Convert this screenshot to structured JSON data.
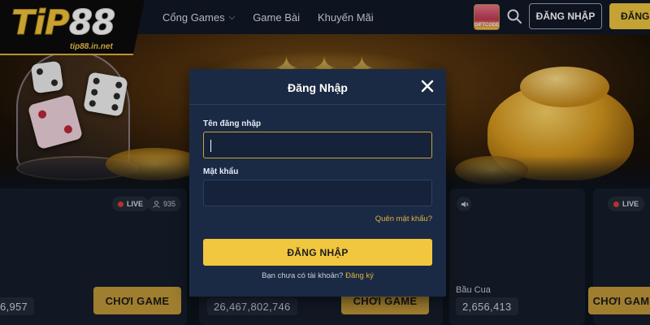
{
  "header": {
    "logo_tip": "TiP",
    "logo_num": "88",
    "logo_domain": "tip88.in.net",
    "nav": [
      {
        "label": "Cổng Games",
        "has_dropdown": true
      },
      {
        "label": "Game Bài"
      },
      {
        "label": "Khuyến Mãi"
      }
    ],
    "giftcode_label": "GIFTCODE",
    "login_label": "ĐĂNG NHẬP",
    "register_label": "ĐĂNG"
  },
  "cards": [
    {
      "jackpot": "6,957",
      "play_label": "CHƠI GAME"
    },
    {
      "live_label": "LIVE",
      "viewers": "935",
      "jackpot": "26,467,802,746",
      "play_label": "CHƠI GAME"
    },
    {
      "game_name": "Bầu Cua",
      "jackpot": "2,656,413"
    },
    {
      "live_label": "LIVE",
      "play_label": "CHƠI GAME"
    }
  ],
  "modal": {
    "title": "Đăng Nhập",
    "username_label": "Tên đăng nhập",
    "username_value": "",
    "password_label": "Mật khẩu",
    "password_value": "",
    "forgot_label": "Quên mật khẩu?",
    "submit_label": "ĐĂNG NHẬP",
    "signup_prompt": "Bạn chưa có tài khoản?",
    "signup_link": "Đăng ký"
  },
  "colors": {
    "accent_gold": "#f1c73f",
    "modal_bg": "#1b2a44",
    "live_red": "#e23a3a"
  }
}
